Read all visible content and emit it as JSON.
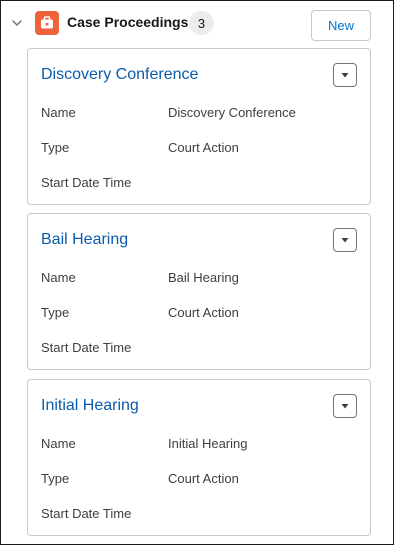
{
  "header": {
    "title": "Case Proceedings",
    "count": "3",
    "new_label": "New",
    "icon_color": "#f0623a",
    "collapse_icon": "chevron-down-icon",
    "app_icon": "briefcase-icon"
  },
  "records": [
    {
      "title": "Discovery Conference",
      "fields": [
        {
          "label": "Name",
          "value": "Discovery Conference"
        },
        {
          "label": "Type",
          "value": "Court Action"
        },
        {
          "label": "Start Date Time",
          "value": ""
        }
      ]
    },
    {
      "title": "Bail Hearing",
      "fields": [
        {
          "label": "Name",
          "value": "Bail Hearing"
        },
        {
          "label": "Type",
          "value": "Court Action"
        },
        {
          "label": "Start Date Time",
          "value": ""
        }
      ]
    },
    {
      "title": "Initial Hearing",
      "fields": [
        {
          "label": "Name",
          "value": "Initial Hearing"
        },
        {
          "label": "Type",
          "value": "Court Action"
        },
        {
          "label": "Start Date Time",
          "value": ""
        }
      ]
    }
  ],
  "colors": {
    "link": "#0b5cab",
    "button_text": "#0176d3",
    "border": "#c9c9c9"
  }
}
